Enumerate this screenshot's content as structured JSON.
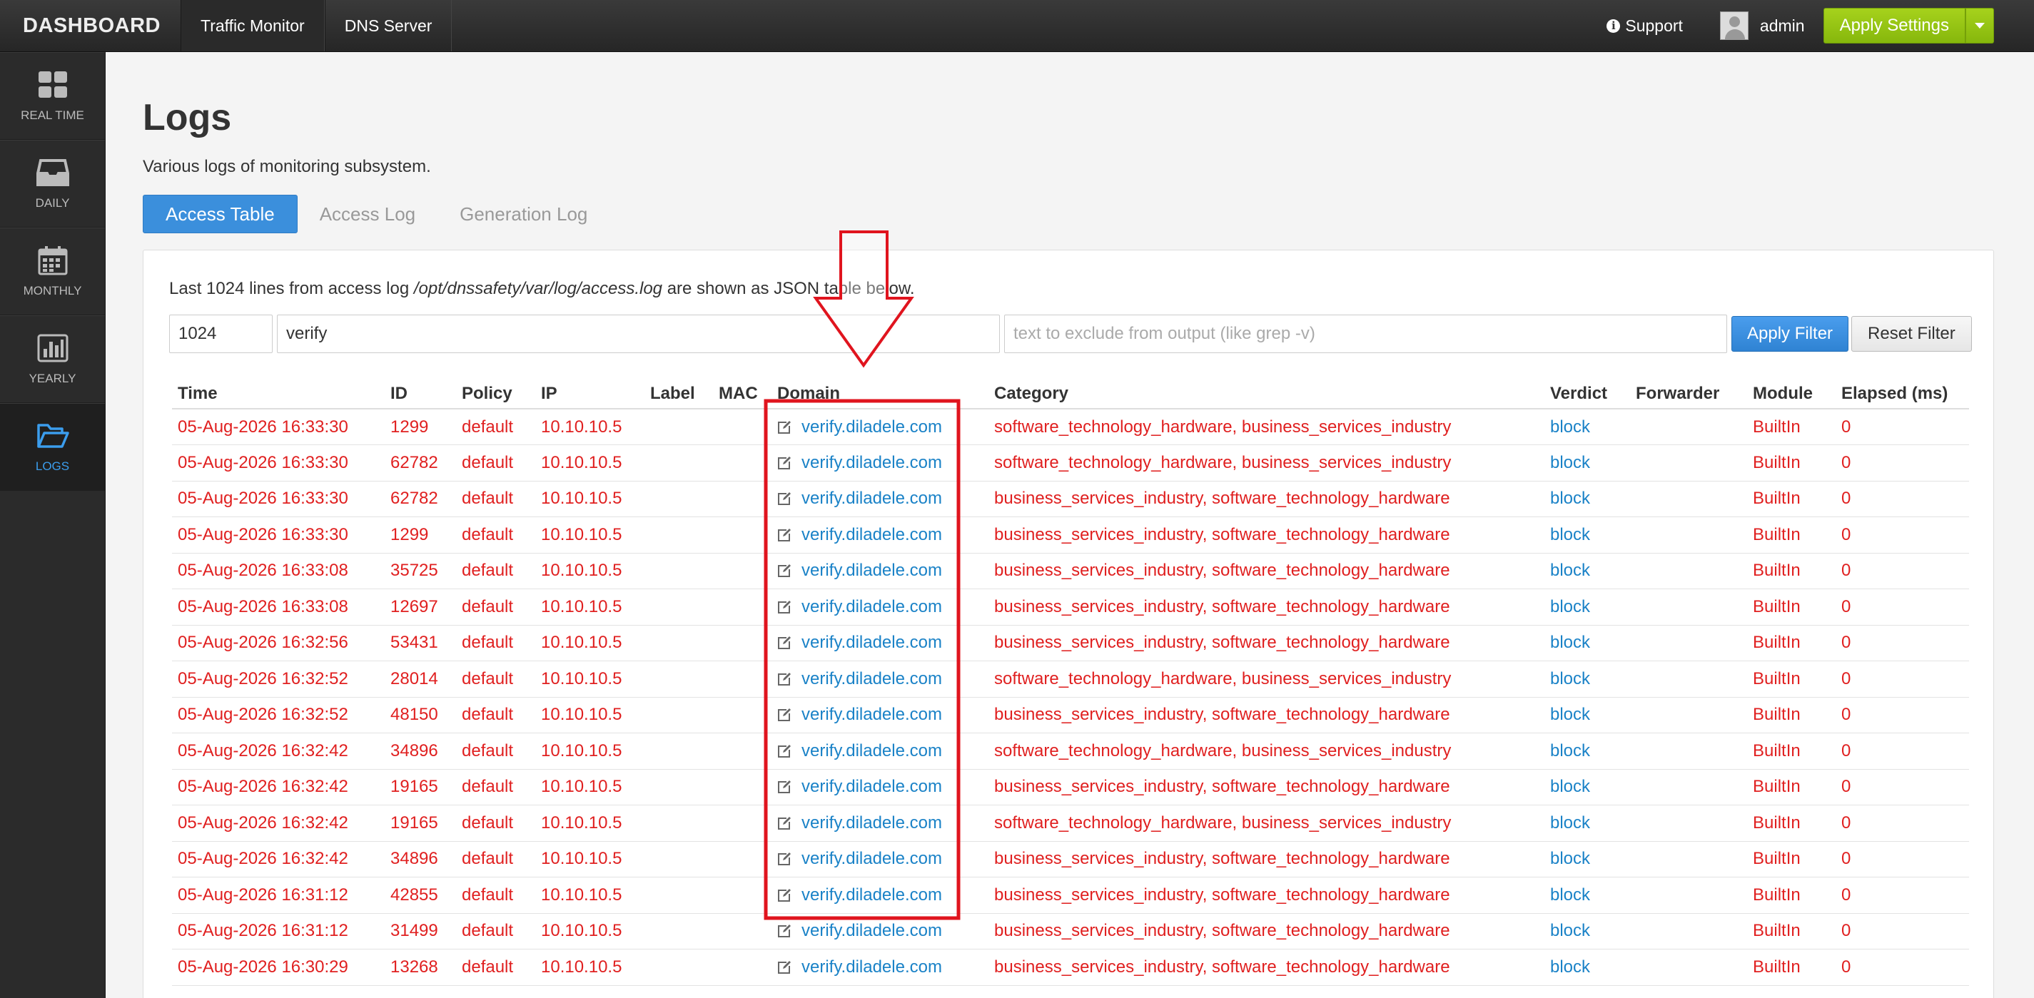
{
  "topbar": {
    "brand": "DASHBOARD",
    "nav": [
      "Traffic Monitor",
      "DNS Server"
    ],
    "support_label": "Support",
    "user_name": "admin",
    "apply_label": "Apply Settings"
  },
  "sidebar": {
    "items": [
      {
        "label": "REAL TIME",
        "icon": "grid-icon"
      },
      {
        "label": "DAILY",
        "icon": "inbox-icon"
      },
      {
        "label": "MONTHLY",
        "icon": "calendar-icon"
      },
      {
        "label": "YEARLY",
        "icon": "bar-chart-icon"
      },
      {
        "label": "LOGS",
        "icon": "folder-open-icon"
      }
    ],
    "active_index": 4
  },
  "page": {
    "title": "Logs",
    "subtitle": "Various logs of monitoring subsystem.",
    "tabs": [
      "Access Table",
      "Access Log",
      "Generation Log"
    ],
    "active_tab": 0
  },
  "panel": {
    "desc_prefix": "Last 1024 lines from access log ",
    "desc_path": "/opt/dnssafety/var/log/access.log",
    "desc_suffix": " are shown as JSON table below.",
    "lines_value": "1024",
    "filter_value": "verify",
    "exclude_placeholder": "text to exclude from output (like grep -v)",
    "apply_filter_label": "Apply Filter",
    "reset_filter_label": "Reset Filter"
  },
  "table": {
    "columns": [
      "Time",
      "ID",
      "Policy",
      "IP",
      "Label",
      "MAC",
      "Domain",
      "Category",
      "Verdict",
      "Forwarder",
      "Module",
      "Elapsed (ms)"
    ],
    "rows": [
      {
        "time": "05-Aug-2026 16:33:30",
        "id": "1299",
        "policy": "default",
        "ip": "10.10.10.5",
        "label": "",
        "mac": "",
        "domain": "verify.diladele.com",
        "category": "software_technology_hardware, business_services_industry",
        "verdict": "block",
        "forwarder": "",
        "module": "BuiltIn",
        "elapsed": "0"
      },
      {
        "time": "05-Aug-2026 16:33:30",
        "id": "62782",
        "policy": "default",
        "ip": "10.10.10.5",
        "label": "",
        "mac": "",
        "domain": "verify.diladele.com",
        "category": "software_technology_hardware, business_services_industry",
        "verdict": "block",
        "forwarder": "",
        "module": "BuiltIn",
        "elapsed": "0"
      },
      {
        "time": "05-Aug-2026 16:33:30",
        "id": "62782",
        "policy": "default",
        "ip": "10.10.10.5",
        "label": "",
        "mac": "",
        "domain": "verify.diladele.com",
        "category": "business_services_industry, software_technology_hardware",
        "verdict": "block",
        "forwarder": "",
        "module": "BuiltIn",
        "elapsed": "0"
      },
      {
        "time": "05-Aug-2026 16:33:30",
        "id": "1299",
        "policy": "default",
        "ip": "10.10.10.5",
        "label": "",
        "mac": "",
        "domain": "verify.diladele.com",
        "category": "business_services_industry, software_technology_hardware",
        "verdict": "block",
        "forwarder": "",
        "module": "BuiltIn",
        "elapsed": "0"
      },
      {
        "time": "05-Aug-2026 16:33:08",
        "id": "35725",
        "policy": "default",
        "ip": "10.10.10.5",
        "label": "",
        "mac": "",
        "domain": "verify.diladele.com",
        "category": "business_services_industry, software_technology_hardware",
        "verdict": "block",
        "forwarder": "",
        "module": "BuiltIn",
        "elapsed": "0"
      },
      {
        "time": "05-Aug-2026 16:33:08",
        "id": "12697",
        "policy": "default",
        "ip": "10.10.10.5",
        "label": "",
        "mac": "",
        "domain": "verify.diladele.com",
        "category": "business_services_industry, software_technology_hardware",
        "verdict": "block",
        "forwarder": "",
        "module": "BuiltIn",
        "elapsed": "0"
      },
      {
        "time": "05-Aug-2026 16:32:56",
        "id": "53431",
        "policy": "default",
        "ip": "10.10.10.5",
        "label": "",
        "mac": "",
        "domain": "verify.diladele.com",
        "category": "business_services_industry, software_technology_hardware",
        "verdict": "block",
        "forwarder": "",
        "module": "BuiltIn",
        "elapsed": "0"
      },
      {
        "time": "05-Aug-2026 16:32:52",
        "id": "28014",
        "policy": "default",
        "ip": "10.10.10.5",
        "label": "",
        "mac": "",
        "domain": "verify.diladele.com",
        "category": "software_technology_hardware, business_services_industry",
        "verdict": "block",
        "forwarder": "",
        "module": "BuiltIn",
        "elapsed": "0"
      },
      {
        "time": "05-Aug-2026 16:32:52",
        "id": "48150",
        "policy": "default",
        "ip": "10.10.10.5",
        "label": "",
        "mac": "",
        "domain": "verify.diladele.com",
        "category": "business_services_industry, software_technology_hardware",
        "verdict": "block",
        "forwarder": "",
        "module": "BuiltIn",
        "elapsed": "0"
      },
      {
        "time": "05-Aug-2026 16:32:42",
        "id": "34896",
        "policy": "default",
        "ip": "10.10.10.5",
        "label": "",
        "mac": "",
        "domain": "verify.diladele.com",
        "category": "software_technology_hardware, business_services_industry",
        "verdict": "block",
        "forwarder": "",
        "module": "BuiltIn",
        "elapsed": "0"
      },
      {
        "time": "05-Aug-2026 16:32:42",
        "id": "19165",
        "policy": "default",
        "ip": "10.10.10.5",
        "label": "",
        "mac": "",
        "domain": "verify.diladele.com",
        "category": "business_services_industry, software_technology_hardware",
        "verdict": "block",
        "forwarder": "",
        "module": "BuiltIn",
        "elapsed": "0"
      },
      {
        "time": "05-Aug-2026 16:32:42",
        "id": "19165",
        "policy": "default",
        "ip": "10.10.10.5",
        "label": "",
        "mac": "",
        "domain": "verify.diladele.com",
        "category": "software_technology_hardware, business_services_industry",
        "verdict": "block",
        "forwarder": "",
        "module": "BuiltIn",
        "elapsed": "0"
      },
      {
        "time": "05-Aug-2026 16:32:42",
        "id": "34896",
        "policy": "default",
        "ip": "10.10.10.5",
        "label": "",
        "mac": "",
        "domain": "verify.diladele.com",
        "category": "business_services_industry, software_technology_hardware",
        "verdict": "block",
        "forwarder": "",
        "module": "BuiltIn",
        "elapsed": "0"
      },
      {
        "time": "05-Aug-2026 16:31:12",
        "id": "42855",
        "policy": "default",
        "ip": "10.10.10.5",
        "label": "",
        "mac": "",
        "domain": "verify.diladele.com",
        "category": "business_services_industry, software_technology_hardware",
        "verdict": "block",
        "forwarder": "",
        "module": "BuiltIn",
        "elapsed": "0"
      },
      {
        "time": "05-Aug-2026 16:31:12",
        "id": "31499",
        "policy": "default",
        "ip": "10.10.10.5",
        "label": "",
        "mac": "",
        "domain": "verify.diladele.com",
        "category": "business_services_industry, software_technology_hardware",
        "verdict": "block",
        "forwarder": "",
        "module": "BuiltIn",
        "elapsed": "0"
      },
      {
        "time": "05-Aug-2026 16:30:29",
        "id": "13268",
        "policy": "default",
        "ip": "10.10.10.5",
        "label": "",
        "mac": "",
        "domain": "verify.diladele.com",
        "category": "business_services_industry, software_technology_hardware",
        "verdict": "block",
        "forwarder": "",
        "module": "BuiltIn",
        "elapsed": "0"
      }
    ]
  },
  "colors": {
    "accent": "#3b8fdc",
    "apply_green": "#94c414",
    "row_text": "#e02020",
    "link": "#1a82c7",
    "annotation": "#e0141e"
  }
}
